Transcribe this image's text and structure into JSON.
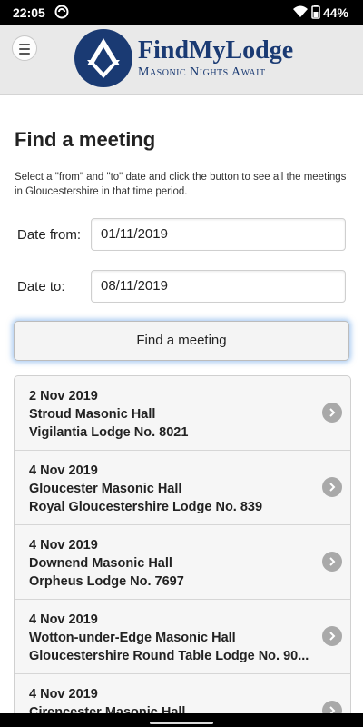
{
  "status_bar": {
    "time": "22:05",
    "battery_percent": "44%",
    "icons": [
      "vpn-icon",
      "wifi-icon",
      "battery-icon"
    ]
  },
  "header": {
    "menu_icon": "hamburger-icon",
    "logo_title": "FindMyLodge",
    "logo_subtitle": "Masonic Nights Await"
  },
  "page": {
    "title": "Find a meeting",
    "intro": "Select a \"from\" and \"to\" date and click the button to see all the meetings in Gloucestershire in that time period."
  },
  "form": {
    "date_from_label": "Date from:",
    "date_from_value": "01/11/2019",
    "date_to_label": "Date to:",
    "date_to_value": "08/11/2019",
    "submit_label": "Find a meeting"
  },
  "results": [
    {
      "date": "2 Nov 2019",
      "hall": "Stroud Masonic Hall",
      "lodge": "Vigilantia Lodge No. 8021"
    },
    {
      "date": "4 Nov 2019",
      "hall": "Gloucester Masonic Hall",
      "lodge": "Royal Gloucestershire Lodge No. 839"
    },
    {
      "date": "4 Nov 2019",
      "hall": "Downend Masonic Hall",
      "lodge": "Orpheus Lodge No. 7697"
    },
    {
      "date": "4 Nov 2019",
      "hall": "Wotton-under-Edge Masonic Hall",
      "lodge": "Gloucestershire Round Table Lodge No. 90..."
    },
    {
      "date": "4 Nov 2019",
      "hall": "Cirencester Masonic Hall",
      "lodge": ""
    }
  ],
  "colors": {
    "brand": "#1a3a73",
    "header_bg": "#e9e9e9",
    "chevron": "#a9a9a9"
  }
}
